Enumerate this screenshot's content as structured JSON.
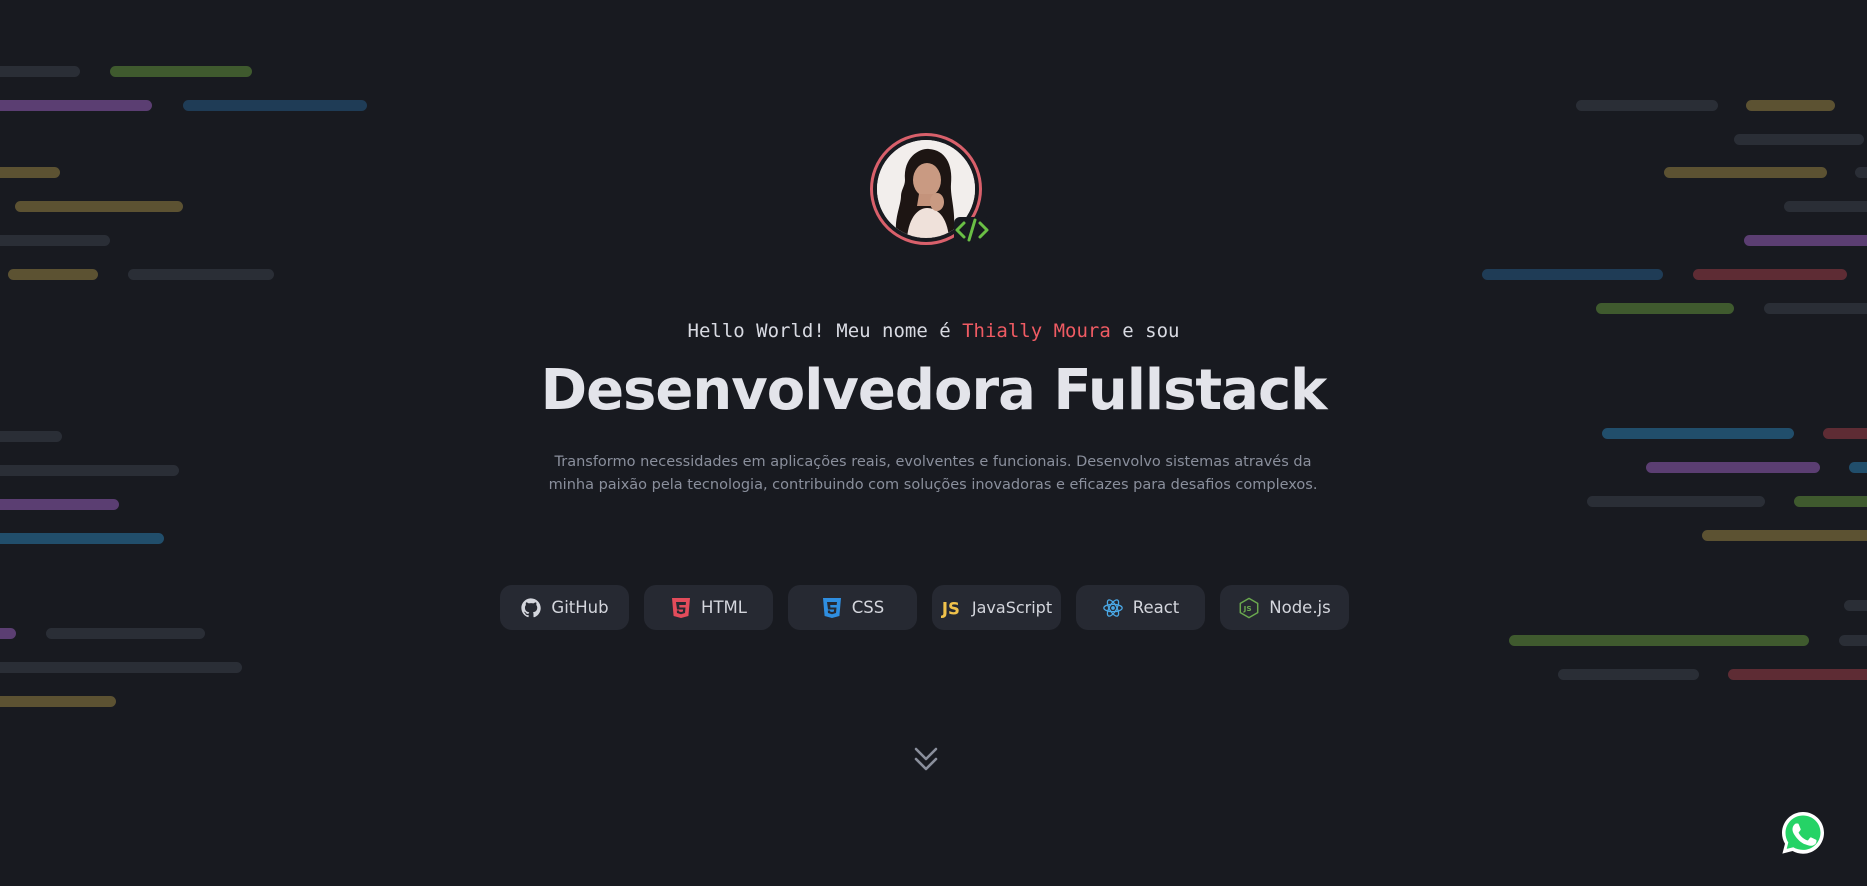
{
  "hero": {
    "greeting_prefix": "Hello World! Meu nome é ",
    "name": "Thially Moura",
    "greeting_suffix": " e sou",
    "title": "Desenvolvedora Fullstack",
    "description": "Transformo necessidades em aplicações reais, evolventes e funcionais. Desenvolvo sistemas através da minha paixão pela tecnologia, contribuindo com soluções inovadoras e eficazes para desafios complexos."
  },
  "techs": [
    {
      "label": "GitHub",
      "icon": "github-icon",
      "color": "#d4d6dd"
    },
    {
      "label": "HTML",
      "icon": "html5-icon",
      "color": "#e34c5b"
    },
    {
      "label": "CSS",
      "icon": "css3-icon",
      "color": "#2f8ee0"
    },
    {
      "label": "JavaScript",
      "icon": "js-icon",
      "color": "#f0c24b"
    },
    {
      "label": "React",
      "icon": "react-icon",
      "color": "#4aa8e6"
    },
    {
      "label": "Node.js",
      "icon": "nodejs-icon",
      "color": "#6aa84f"
    }
  ],
  "colors": {
    "background": "#181a20",
    "accent": "#ef5b63",
    "ring": "#d9606b",
    "code_badge": "#6abf45",
    "whatsapp": "#25d366"
  },
  "icons": {
    "scroll": "chevrons-down-icon",
    "whatsapp": "whatsapp-icon",
    "badge": "code-icon"
  }
}
